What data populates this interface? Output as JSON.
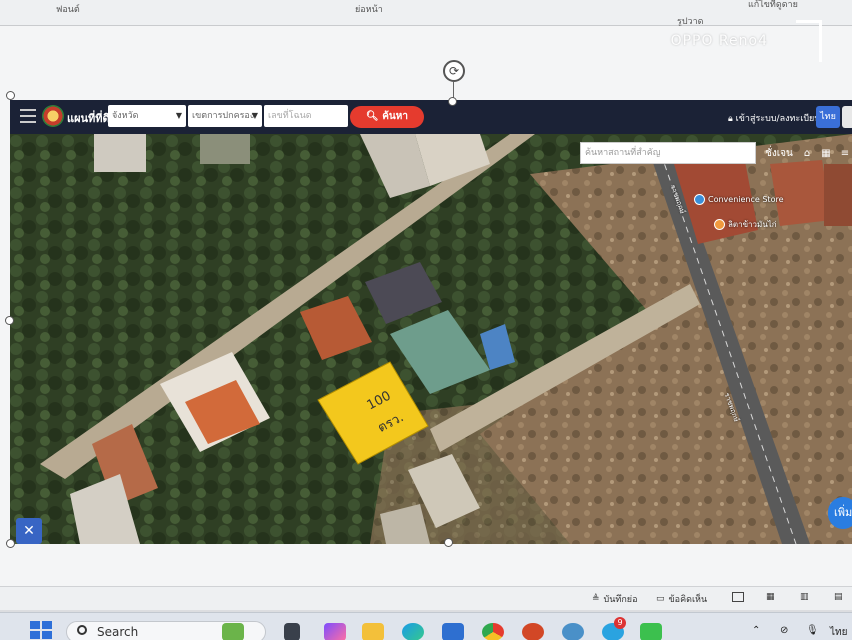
{
  "document": {
    "ribbon_labels": [
      "ฟอนต์",
      "ย่อหน้า",
      "รูปวาด"
    ],
    "ribbon_right": "แก้ไขที่ดูดาย",
    "watermark": "OPPO Reno4"
  },
  "map_app": {
    "brand": "แผนที่ที่ดิน",
    "province_select": "จังหวัด",
    "district_select": "เขตการปกครอง",
    "parcel_input_placeholder": "เลขที่โฉนด",
    "search_button": "ค้นหา",
    "login_link": "เข้าสู่ระบบ/ลงทะเบียน",
    "language": "ไทย",
    "map_search_placeholder": "ค้นหาสถานที่สำคัญ",
    "map_tool_label": "ชั่งเจน",
    "pois": [
      {
        "name": "Convenience Store",
        "icon": "store-icon",
        "color": "#3a8fd8"
      },
      {
        "name": "ลิตาข้าวมันไก่",
        "icon": "restaurant-icon",
        "color": "#f09a3e"
      }
    ],
    "road_labels": [
      "ราชพฤกษ์",
      "ราชพฤกษ์"
    ],
    "plot": {
      "area": "100",
      "unit": "ตรว.",
      "color": "#f3c81d"
    },
    "add_button": "เพิ่ม"
  },
  "doc_status": {
    "notes": "บันทึกย่อ",
    "comments": "ข้อคิดเห็น"
  },
  "taskbar": {
    "search_placeholder": "Search",
    "badge_count": "9",
    "tray_lang": "ไทย"
  }
}
